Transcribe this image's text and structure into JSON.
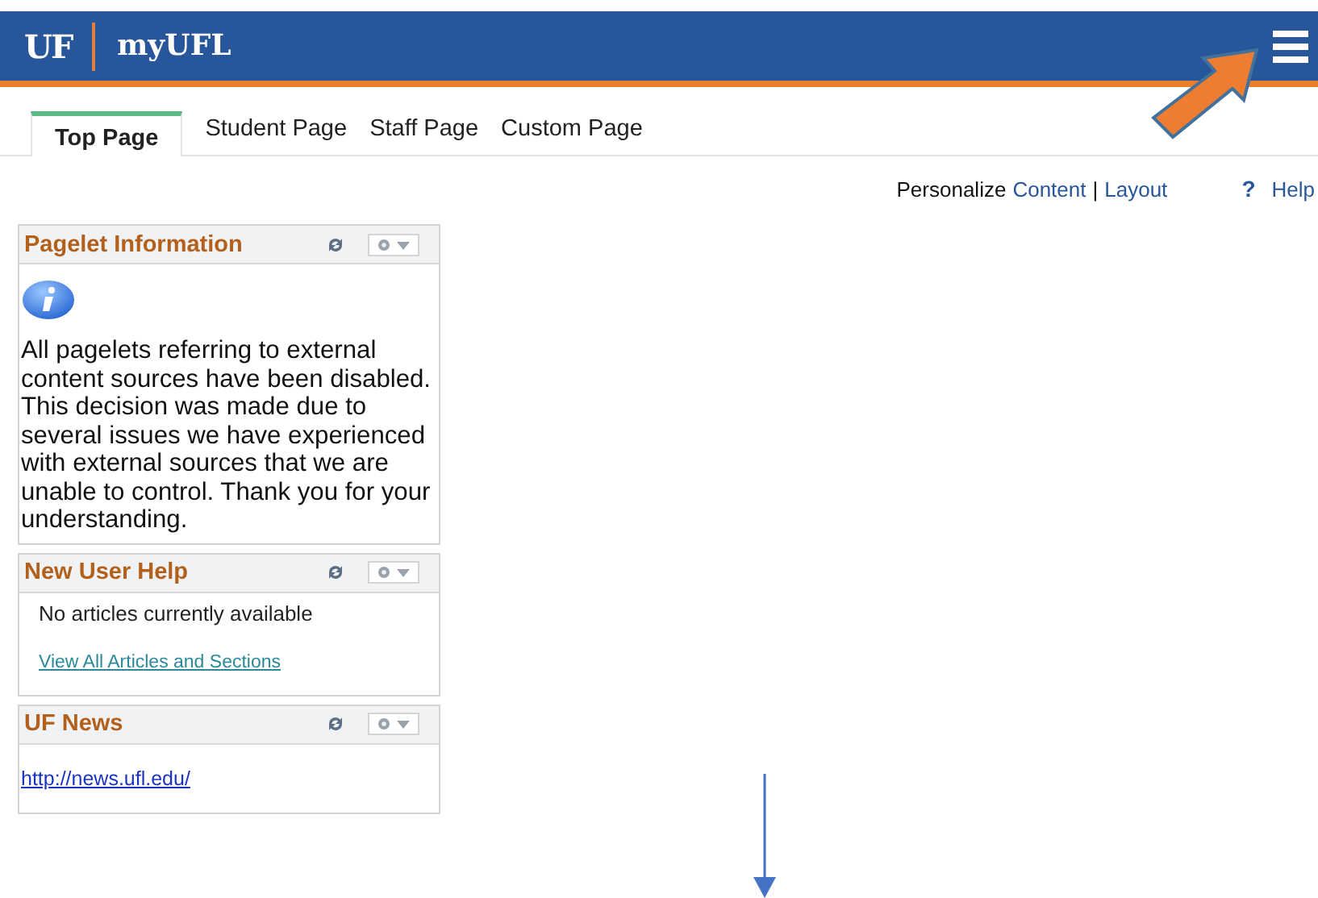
{
  "header": {
    "logo": "UF",
    "title": "myUFL"
  },
  "tabs": [
    {
      "label": "Top Page",
      "selected": true
    },
    {
      "label": "Student Page",
      "selected": false
    },
    {
      "label": "Staff Page",
      "selected": false
    },
    {
      "label": "Custom Page",
      "selected": false
    }
  ],
  "toolbar": {
    "personalize": "Personalize",
    "content_link": "Content",
    "separator": "|",
    "layout_link": "Layout",
    "help_icon": "?",
    "help": "Help"
  },
  "pagelets": [
    {
      "title": "Pagelet Information",
      "kind": "message",
      "text": "All pagelets referring to external content sources have been disabled. This decision was made due to several issues we have experienced with external sources that we are unable to control. Thank you for your understanding."
    },
    {
      "title": "New User Help",
      "kind": "articles",
      "text": "No articles currently available",
      "link": "View All Articles and Sections"
    },
    {
      "title": "UF News",
      "kind": "link",
      "link": "http://news.ufl.edu/"
    }
  ]
}
